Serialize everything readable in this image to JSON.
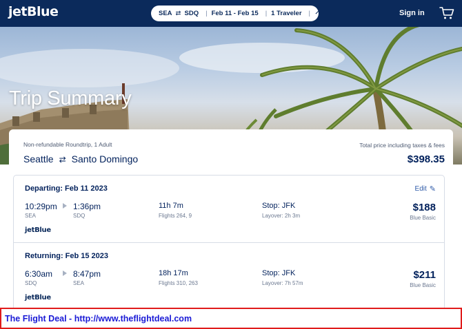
{
  "header": {
    "logo": "jetBlue",
    "origin": "SEA",
    "destination": "SDQ",
    "dates": "Feb 11 - Feb 15",
    "travelers": "1 Traveler",
    "signin_label": "Sign in"
  },
  "hero": {
    "title": "Trip Summary"
  },
  "summary": {
    "fare_note": "Non-refundable Roundtrip, 1 Adult",
    "origin_city": "Seattle",
    "destination_city": "Santo Domingo",
    "total_note": "Total price including taxes & fees",
    "total_price": "$398.35"
  },
  "departing": {
    "title": "Departing: Feb 11 2023",
    "edit_label": "Edit",
    "depart_time": "10:29pm",
    "depart_code": "SEA",
    "arrive_time": "1:36pm",
    "arrive_code": "SDQ",
    "duration": "11h 7m",
    "flights": "Flights 264, 9",
    "stop": "Stop: JFK",
    "layover": "Layover: 2h 3m",
    "price": "$188",
    "fare_class": "Blue Basic",
    "airline_logo": "jetBlue"
  },
  "returning": {
    "title": "Returning: Feb 15 2023",
    "depart_time": "6:30am",
    "depart_code": "SDQ",
    "arrive_time": "8:47pm",
    "arrive_code": "SEA",
    "duration": "18h 17m",
    "flights": "Flights 310, 263",
    "stop": "Stop: JFK",
    "layover": "Layover: 7h 57m",
    "price": "$211",
    "fare_class": "Blue Basic",
    "airline_logo": "jetBlue"
  },
  "banner": {
    "text": "The Flight Deal - http://www.theflightdeal.com"
  },
  "icons": {
    "swap": "swap-arrows-icon",
    "cart": "cart-icon",
    "edit": "pencil-icon",
    "chevron": "chevron-down-icon",
    "segment": "play-triangle-icon"
  },
  "colors": {
    "header_bg": "#0b2a5b",
    "text_navy": "#00205b",
    "link_blue": "#2e5aa8",
    "banner_border": "#e01b1b",
    "banner_text": "#1a1ad6"
  }
}
